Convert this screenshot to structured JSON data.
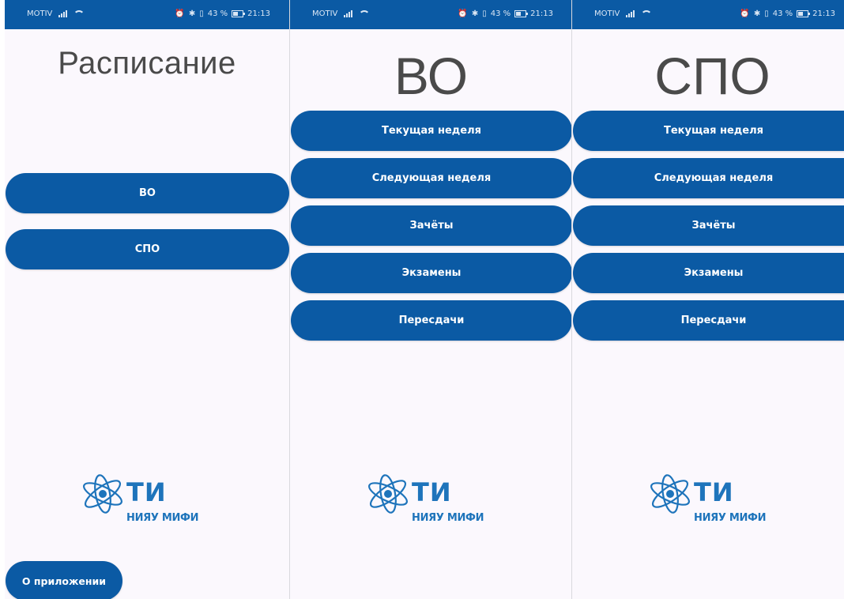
{
  "statusbar": {
    "carrier": "MOTIV",
    "battery": "43 %",
    "time": "21:13"
  },
  "screen_main": {
    "title": "Расписание",
    "buttons": [
      "ВО",
      "СПО"
    ],
    "about_button": "О приложении"
  },
  "screen_vo": {
    "title": "ВО",
    "menu": [
      "Текущая неделя",
      "Следующая неделя",
      "Зачёты",
      "Экзамены",
      "Пересдачи"
    ]
  },
  "screen_spo": {
    "title": "СПО",
    "menu": [
      "Текущая неделя",
      "Следующая неделя",
      "Зачёты",
      "Экзамены",
      "Пересдачи"
    ]
  },
  "logo": {
    "abbr": "ТИ",
    "subtitle": "НИЯУ МИФИ"
  },
  "colors": {
    "primary": "#0b5aa4",
    "background": "#fbf8fd",
    "logo": "#1e74bb",
    "title_text": "#4a4a4a"
  }
}
